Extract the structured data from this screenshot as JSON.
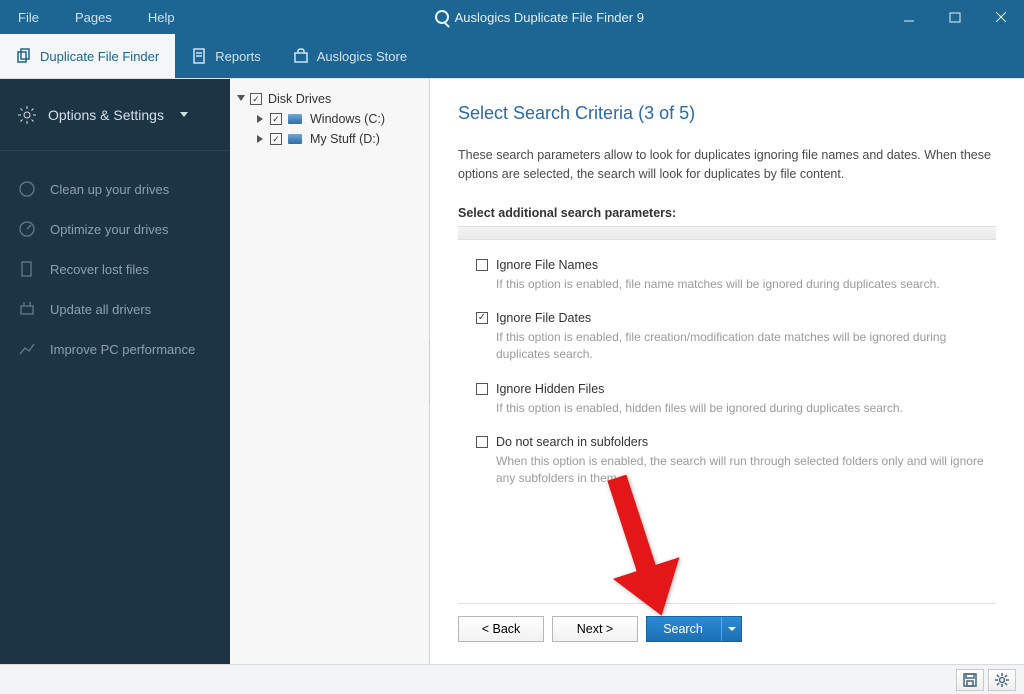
{
  "window": {
    "menu": [
      "File",
      "Pages",
      "Help"
    ],
    "title": "Auslogics Duplicate File Finder 9"
  },
  "ribbon": {
    "tabs": [
      {
        "label": "Duplicate File Finder",
        "active": true
      },
      {
        "label": "Reports",
        "active": false
      },
      {
        "label": "Auslogics Store",
        "active": false
      }
    ]
  },
  "sidebar": {
    "head": "Options & Settings",
    "items": [
      "Clean up your drives",
      "Optimize your drives",
      "Recover lost files",
      "Update all drivers",
      "Improve PC performance"
    ]
  },
  "tree": {
    "root": "Disk Drives",
    "drives": [
      {
        "label": "Windows (C:)"
      },
      {
        "label": "My Stuff (D:)"
      }
    ]
  },
  "page": {
    "title": "Select Search Criteria (3 of 5)",
    "description": "These search parameters allow to look for duplicates ignoring file names and dates. When these options are selected, the search will look for duplicates by file content.",
    "subhead": "Select additional search parameters:",
    "options": [
      {
        "label": "Ignore File Names",
        "checked": false,
        "hint": "If this option is enabled, file name matches will be ignored during duplicates search."
      },
      {
        "label": "Ignore File Dates",
        "checked": true,
        "hint": "If this option is enabled, file creation/modification date matches will be ignored during duplicates search."
      },
      {
        "label": "Ignore Hidden Files",
        "checked": false,
        "hint": "If this option is enabled, hidden files will be ignored during duplicates search."
      },
      {
        "label": "Do not search in subfolders",
        "checked": false,
        "hint": "When this option is enabled, the search will run through selected folders only and will ignore any subfolders in them"
      }
    ],
    "nav": {
      "back": "< Back",
      "next": "Next >",
      "search": "Search"
    }
  }
}
